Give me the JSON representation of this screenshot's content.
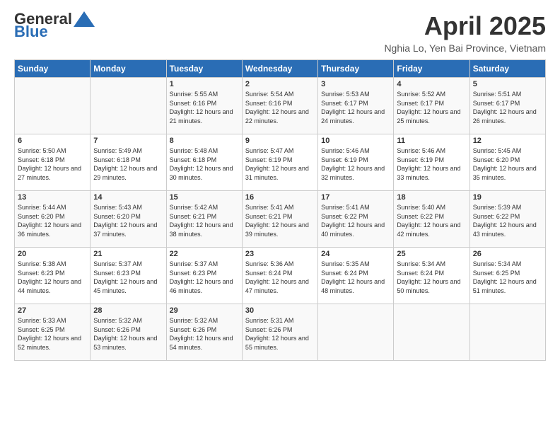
{
  "header": {
    "logo_line1": "General",
    "logo_line2": "Blue",
    "title": "April 2025",
    "subtitle": "Nghia Lo, Yen Bai Province, Vietnam"
  },
  "columns": [
    "Sunday",
    "Monday",
    "Tuesday",
    "Wednesday",
    "Thursday",
    "Friday",
    "Saturday"
  ],
  "weeks": [
    [
      {
        "day": "",
        "info": ""
      },
      {
        "day": "",
        "info": ""
      },
      {
        "day": "1",
        "info": "Sunrise: 5:55 AM\nSunset: 6:16 PM\nDaylight: 12 hours and 21 minutes."
      },
      {
        "day": "2",
        "info": "Sunrise: 5:54 AM\nSunset: 6:16 PM\nDaylight: 12 hours and 22 minutes."
      },
      {
        "day": "3",
        "info": "Sunrise: 5:53 AM\nSunset: 6:17 PM\nDaylight: 12 hours and 24 minutes."
      },
      {
        "day": "4",
        "info": "Sunrise: 5:52 AM\nSunset: 6:17 PM\nDaylight: 12 hours and 25 minutes."
      },
      {
        "day": "5",
        "info": "Sunrise: 5:51 AM\nSunset: 6:17 PM\nDaylight: 12 hours and 26 minutes."
      }
    ],
    [
      {
        "day": "6",
        "info": "Sunrise: 5:50 AM\nSunset: 6:18 PM\nDaylight: 12 hours and 27 minutes."
      },
      {
        "day": "7",
        "info": "Sunrise: 5:49 AM\nSunset: 6:18 PM\nDaylight: 12 hours and 29 minutes."
      },
      {
        "day": "8",
        "info": "Sunrise: 5:48 AM\nSunset: 6:18 PM\nDaylight: 12 hours and 30 minutes."
      },
      {
        "day": "9",
        "info": "Sunrise: 5:47 AM\nSunset: 6:19 PM\nDaylight: 12 hours and 31 minutes."
      },
      {
        "day": "10",
        "info": "Sunrise: 5:46 AM\nSunset: 6:19 PM\nDaylight: 12 hours and 32 minutes."
      },
      {
        "day": "11",
        "info": "Sunrise: 5:46 AM\nSunset: 6:19 PM\nDaylight: 12 hours and 33 minutes."
      },
      {
        "day": "12",
        "info": "Sunrise: 5:45 AM\nSunset: 6:20 PM\nDaylight: 12 hours and 35 minutes."
      }
    ],
    [
      {
        "day": "13",
        "info": "Sunrise: 5:44 AM\nSunset: 6:20 PM\nDaylight: 12 hours and 36 minutes."
      },
      {
        "day": "14",
        "info": "Sunrise: 5:43 AM\nSunset: 6:20 PM\nDaylight: 12 hours and 37 minutes."
      },
      {
        "day": "15",
        "info": "Sunrise: 5:42 AM\nSunset: 6:21 PM\nDaylight: 12 hours and 38 minutes."
      },
      {
        "day": "16",
        "info": "Sunrise: 5:41 AM\nSunset: 6:21 PM\nDaylight: 12 hours and 39 minutes."
      },
      {
        "day": "17",
        "info": "Sunrise: 5:41 AM\nSunset: 6:22 PM\nDaylight: 12 hours and 40 minutes."
      },
      {
        "day": "18",
        "info": "Sunrise: 5:40 AM\nSunset: 6:22 PM\nDaylight: 12 hours and 42 minutes."
      },
      {
        "day": "19",
        "info": "Sunrise: 5:39 AM\nSunset: 6:22 PM\nDaylight: 12 hours and 43 minutes."
      }
    ],
    [
      {
        "day": "20",
        "info": "Sunrise: 5:38 AM\nSunset: 6:23 PM\nDaylight: 12 hours and 44 minutes."
      },
      {
        "day": "21",
        "info": "Sunrise: 5:37 AM\nSunset: 6:23 PM\nDaylight: 12 hours and 45 minutes."
      },
      {
        "day": "22",
        "info": "Sunrise: 5:37 AM\nSunset: 6:23 PM\nDaylight: 12 hours and 46 minutes."
      },
      {
        "day": "23",
        "info": "Sunrise: 5:36 AM\nSunset: 6:24 PM\nDaylight: 12 hours and 47 minutes."
      },
      {
        "day": "24",
        "info": "Sunrise: 5:35 AM\nSunset: 6:24 PM\nDaylight: 12 hours and 48 minutes."
      },
      {
        "day": "25",
        "info": "Sunrise: 5:34 AM\nSunset: 6:24 PM\nDaylight: 12 hours and 50 minutes."
      },
      {
        "day": "26",
        "info": "Sunrise: 5:34 AM\nSunset: 6:25 PM\nDaylight: 12 hours and 51 minutes."
      }
    ],
    [
      {
        "day": "27",
        "info": "Sunrise: 5:33 AM\nSunset: 6:25 PM\nDaylight: 12 hours and 52 minutes."
      },
      {
        "day": "28",
        "info": "Sunrise: 5:32 AM\nSunset: 6:26 PM\nDaylight: 12 hours and 53 minutes."
      },
      {
        "day": "29",
        "info": "Sunrise: 5:32 AM\nSunset: 6:26 PM\nDaylight: 12 hours and 54 minutes."
      },
      {
        "day": "30",
        "info": "Sunrise: 5:31 AM\nSunset: 6:26 PM\nDaylight: 12 hours and 55 minutes."
      },
      {
        "day": "",
        "info": ""
      },
      {
        "day": "",
        "info": ""
      },
      {
        "day": "",
        "info": ""
      }
    ]
  ]
}
